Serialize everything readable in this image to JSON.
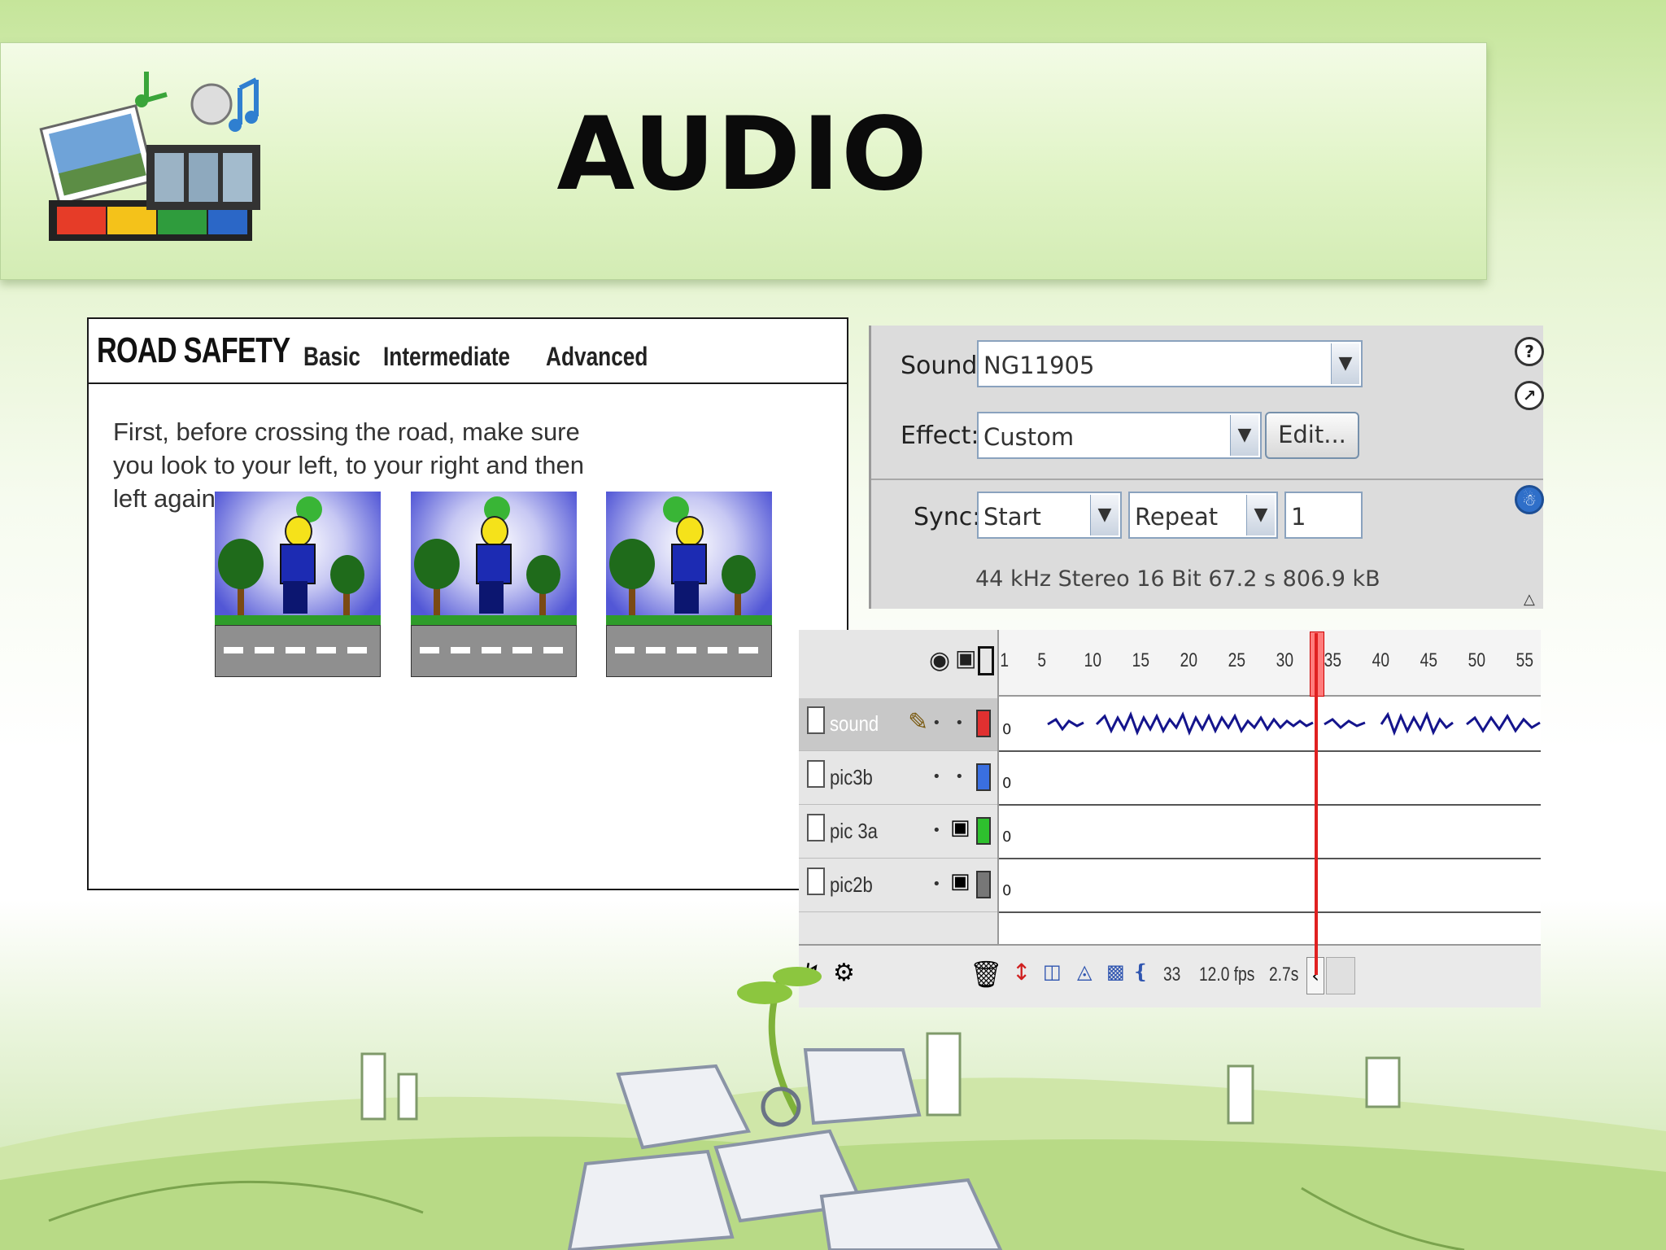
{
  "slide": {
    "title": "AUDIO"
  },
  "road_safety": {
    "title": "ROAD SAFETY",
    "nav": [
      "Basic",
      "Intermediate",
      "Advanced"
    ],
    "body": "First, before crossing the road, make sure you look to your left, to your right and then left again."
  },
  "sound_panel": {
    "sound_label": "Sound:",
    "sound_value": "NG11905",
    "effect_label": "Effect:",
    "effect_value": "Custom",
    "edit_button": "Edit...",
    "sync_label": "Sync:",
    "sync_value": "Start",
    "repeat_value": "Repeat",
    "repeat_count": "1",
    "info": "44 kHz Stereo 16 Bit 67.2 s 806.9 kB"
  },
  "timeline": {
    "ruler": [
      "1",
      "5",
      "10",
      "15",
      "20",
      "25",
      "30",
      "35",
      "40",
      "45",
      "50",
      "55"
    ],
    "layers": [
      {
        "name": "sound",
        "color": "#e03030"
      },
      {
        "name": "pic3b",
        "color": "#3a6fe0"
      },
      {
        "name": "pic 3a",
        "color": "#2ec02e"
      },
      {
        "name": "pic2b",
        "color": "#777777"
      }
    ],
    "frame_zero": "0",
    "current_frame": "33",
    "fps": "12.0 fps",
    "time": "2.7s"
  }
}
